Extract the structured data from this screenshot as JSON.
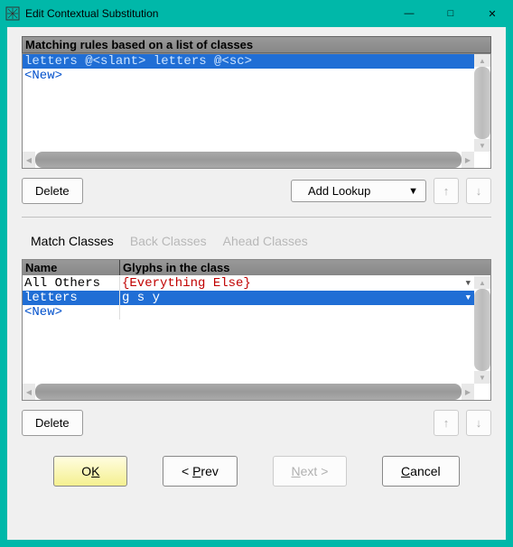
{
  "window": {
    "title": "Edit Contextual Substitution"
  },
  "rules": {
    "header": "Matching rules based on a list of classes",
    "items": [
      "letters @<slant> letters @<sc>"
    ],
    "new_label": "<New>"
  },
  "toolbar": {
    "delete": "Delete",
    "add_lookup": "Add Lookup"
  },
  "tabs": {
    "match": "Match Classes",
    "back": "Back Classes",
    "ahead": "Ahead Classes"
  },
  "classes": {
    "col_name": "Name",
    "col_glyphs": "Glyphs in the class",
    "rows": [
      {
        "name": "All Others",
        "glyphs": "{Everything Else}"
      },
      {
        "name": "letters",
        "glyphs": "g s y"
      }
    ],
    "new_label": "<New>"
  },
  "toolbar2": {
    "delete": "Delete"
  },
  "buttons": {
    "ok_pre": "O",
    "ok_ul": "K",
    "prev_pre": "< ",
    "prev_ul": "P",
    "prev_post": "rev",
    "next_ul": "N",
    "next_post": "ext >",
    "cancel_ul": "C",
    "cancel_post": "ancel"
  }
}
